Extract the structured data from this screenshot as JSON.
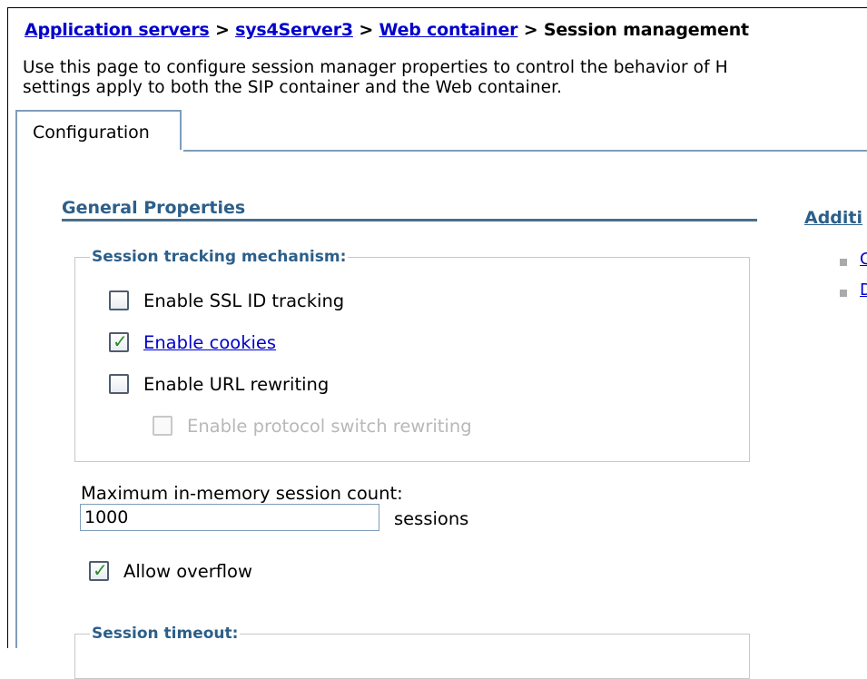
{
  "breadcrumb": {
    "items": [
      "Application servers",
      "sys4Server3",
      "Web container"
    ],
    "current": "Session management",
    "separator": " > "
  },
  "description": {
    "line1": "Use this page to configure session manager properties to control the behavior of H",
    "line2": "settings apply to both the SIP container and the Web container."
  },
  "tabs": [
    {
      "label": "Configuration",
      "selected": true
    }
  ],
  "general_properties": {
    "title": "General Properties",
    "session_tracking": {
      "legend": "Session tracking mechanism:",
      "options": [
        {
          "label": "Enable SSL ID tracking",
          "checked": false,
          "enabled": true,
          "link": false
        },
        {
          "label": "Enable cookies",
          "checked": true,
          "enabled": true,
          "link": true
        },
        {
          "label": "Enable URL rewriting",
          "checked": false,
          "enabled": true,
          "link": false
        },
        {
          "label": "Enable protocol switch rewriting",
          "checked": false,
          "enabled": false,
          "link": false
        }
      ]
    },
    "max_session_count": {
      "label": "Maximum in-memory session count:",
      "value": "1000",
      "unit": "sessions"
    },
    "allow_overflow": {
      "label": "Allow overflow",
      "checked": true
    },
    "session_timeout": {
      "legend": "Session timeout:"
    }
  },
  "additional_properties": {
    "title": "Additi",
    "links": [
      "C",
      "D"
    ]
  },
  "colors": {
    "link": "#0000cc",
    "section_title": "#2c5f8a",
    "tab_border": "#7f9db9",
    "check_tick": "#2a8a2a"
  }
}
